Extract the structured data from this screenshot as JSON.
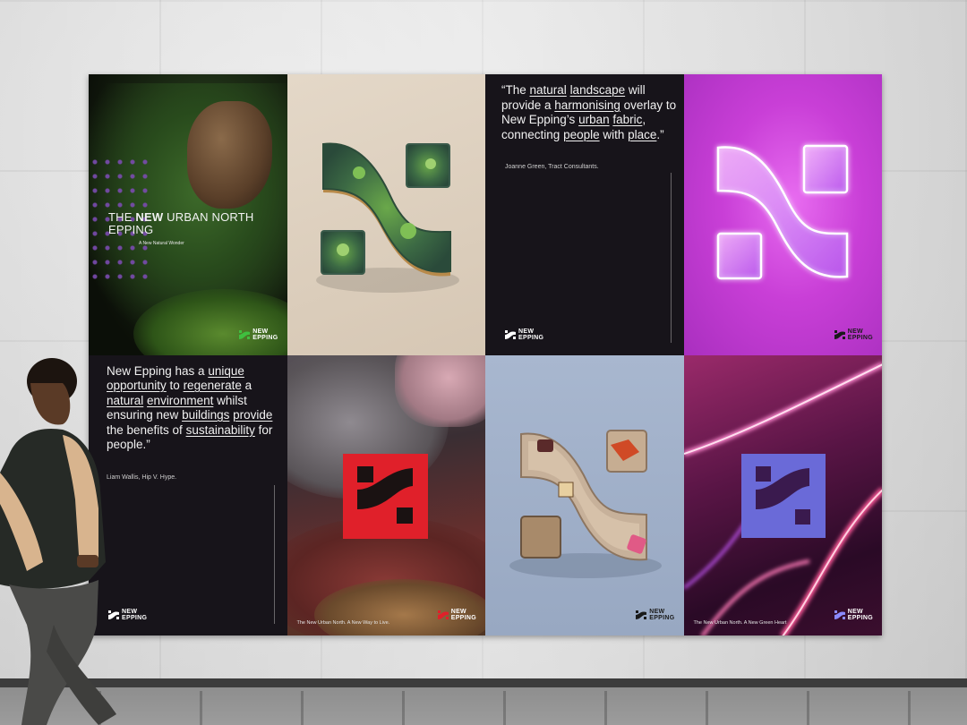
{
  "brand": {
    "line1": "NEW",
    "line2": "EPPING"
  },
  "posters": {
    "p1": {
      "headline_pre": "THE ",
      "headline_bold": "NEW",
      "headline_post": " URBAN NORTH",
      "headline_line2": "EPPING",
      "subline": "A New Natural Wonder"
    },
    "p3": {
      "quote_parts": [
        "“The ",
        "natural",
        " ",
        "landscape",
        " will provide a ",
        "harmonising",
        " overlay to New Epping’s ",
        "urban",
        " ",
        "fabric",
        ", connecting ",
        "people",
        " with ",
        "place",
        ".”"
      ],
      "attribution": "Joanne Green, Tract Consultants."
    },
    "p5": {
      "quote_parts": [
        "New Epping has a ",
        "unique",
        " ",
        "opportunity",
        " to ",
        "regenerate",
        " a ",
        "natural",
        " ",
        "environment",
        " whilst ensuring new ",
        "buildings",
        " ",
        "provide",
        " the benefits of ",
        "sustainability",
        " for people.”"
      ],
      "attribution": "Liam Wallis, Hip V. Hype."
    },
    "p6": {
      "caption": "The New Urban North. A New Way to Live."
    },
    "p8": {
      "caption": "The New Urban North. A New Green Heart"
    }
  },
  "colors": {
    "accent_green": "#3fbf3f",
    "accent_red": "#e0202a",
    "accent_purple": "#6a6ad8",
    "quote_bg": "#17141a"
  },
  "icons": [
    "n-logo-icon"
  ]
}
